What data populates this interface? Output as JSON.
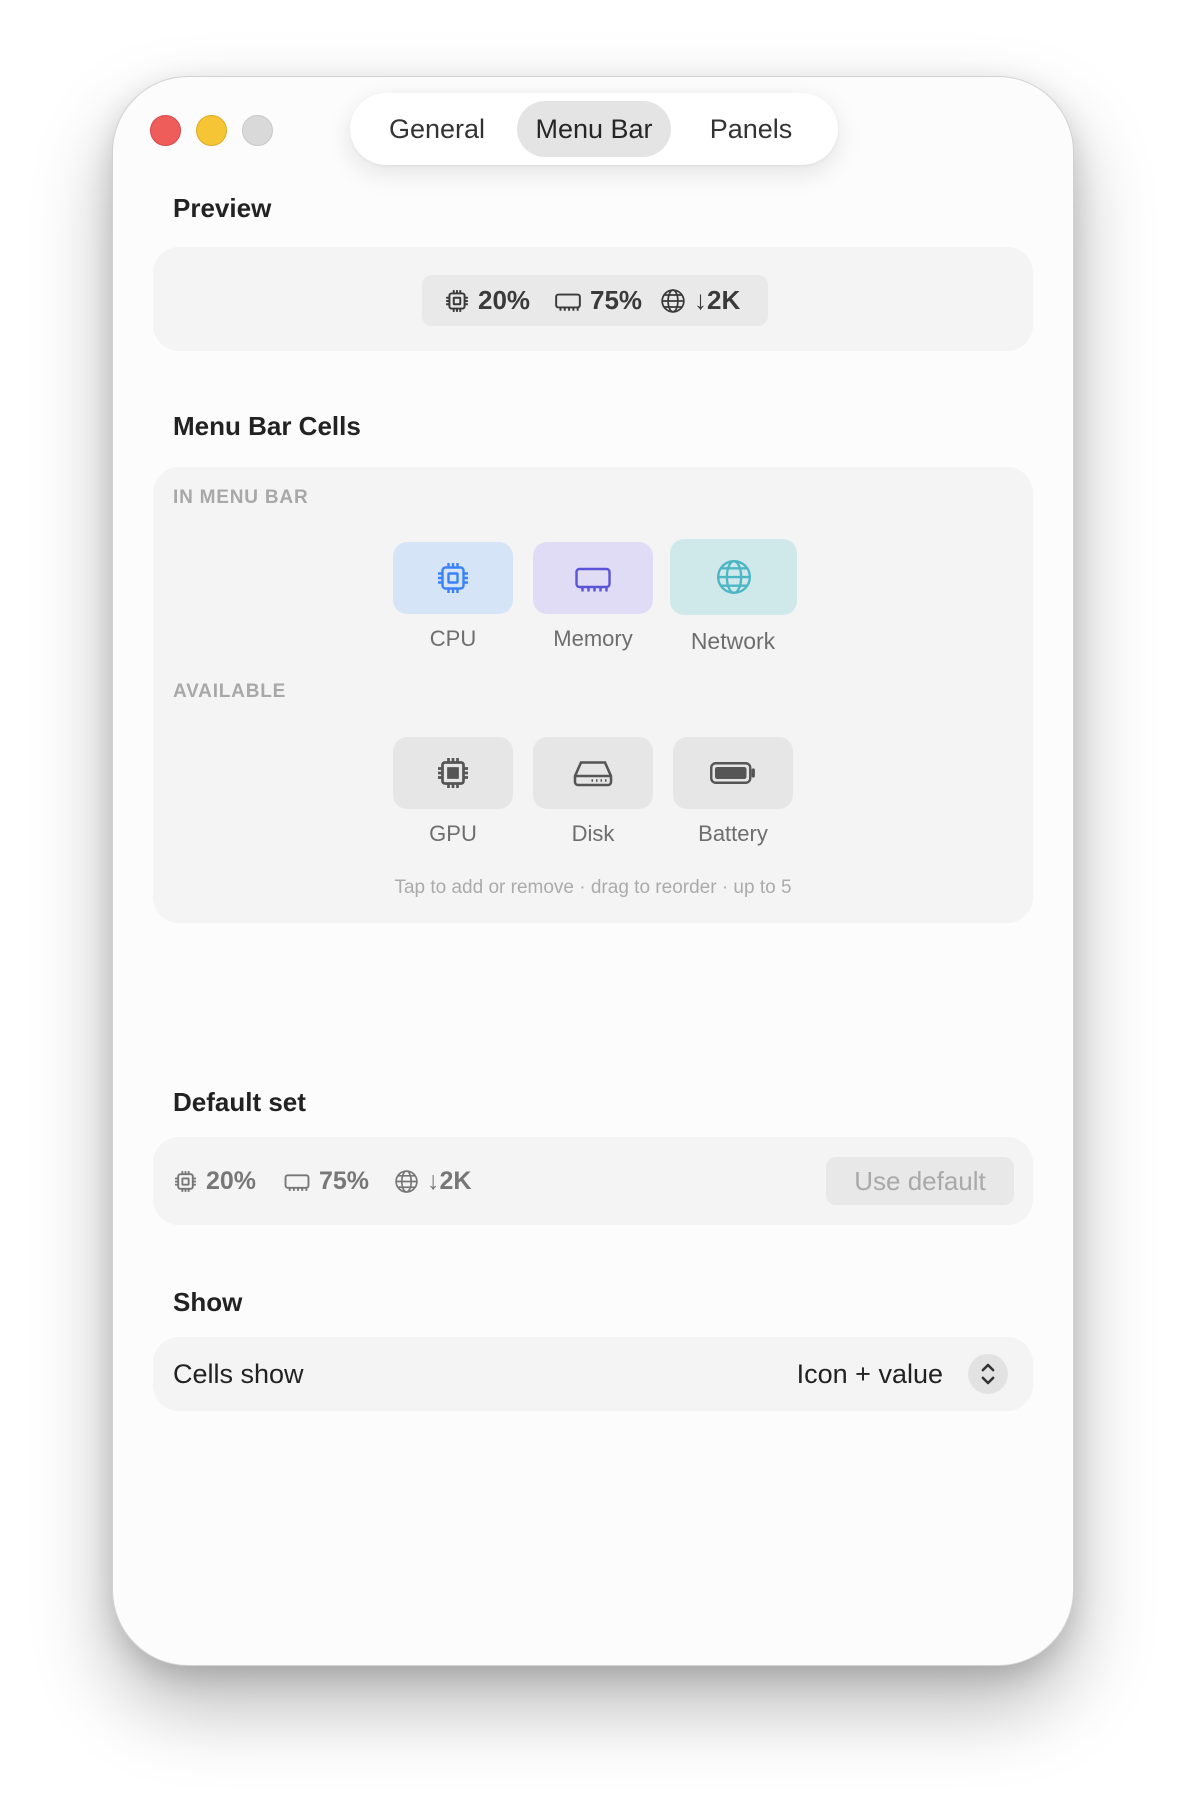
{
  "window": {
    "tabs": [
      {
        "label": "General",
        "selected": false
      },
      {
        "label": "Menu Bar",
        "selected": true
      },
      {
        "label": "Panels",
        "selected": false
      }
    ]
  },
  "preview": {
    "title": "Preview",
    "metrics": [
      {
        "icon": "cpu-icon",
        "value": "20%"
      },
      {
        "icon": "memory-icon",
        "value": "75%"
      },
      {
        "icon": "network-icon",
        "value": "↓2K"
      }
    ]
  },
  "cells": {
    "title": "Menu Bar Cells",
    "in_menu_bar_label": "IN MENU BAR",
    "in_menu_bar": [
      {
        "label": "CPU",
        "icon": "cpu-icon",
        "color": "#3b82f6",
        "bg": "#d6e4f8"
      },
      {
        "label": "Memory",
        "icon": "memory-icon",
        "color": "#5b54d6",
        "bg": "#e0dcf6"
      },
      {
        "label": "Network",
        "icon": "network-icon",
        "color": "#4db6c4",
        "bg": "#cfe9ea"
      }
    ],
    "available_label": "AVAILABLE",
    "available": [
      {
        "label": "GPU",
        "icon": "gpu-icon"
      },
      {
        "label": "Disk",
        "icon": "disk-icon"
      },
      {
        "label": "Battery",
        "icon": "battery-icon"
      }
    ],
    "hint": "Tap to add or remove · drag to reorder · up to 5"
  },
  "default_set": {
    "title": "Default set",
    "metrics": [
      {
        "icon": "cpu-icon",
        "value": "20%"
      },
      {
        "icon": "memory-icon",
        "value": "75%"
      },
      {
        "icon": "network-icon",
        "value": "↓2K"
      }
    ],
    "button_label": "Use default"
  },
  "show": {
    "title": "Show",
    "row_label": "Cells show",
    "selected_option": "Icon + value"
  }
}
